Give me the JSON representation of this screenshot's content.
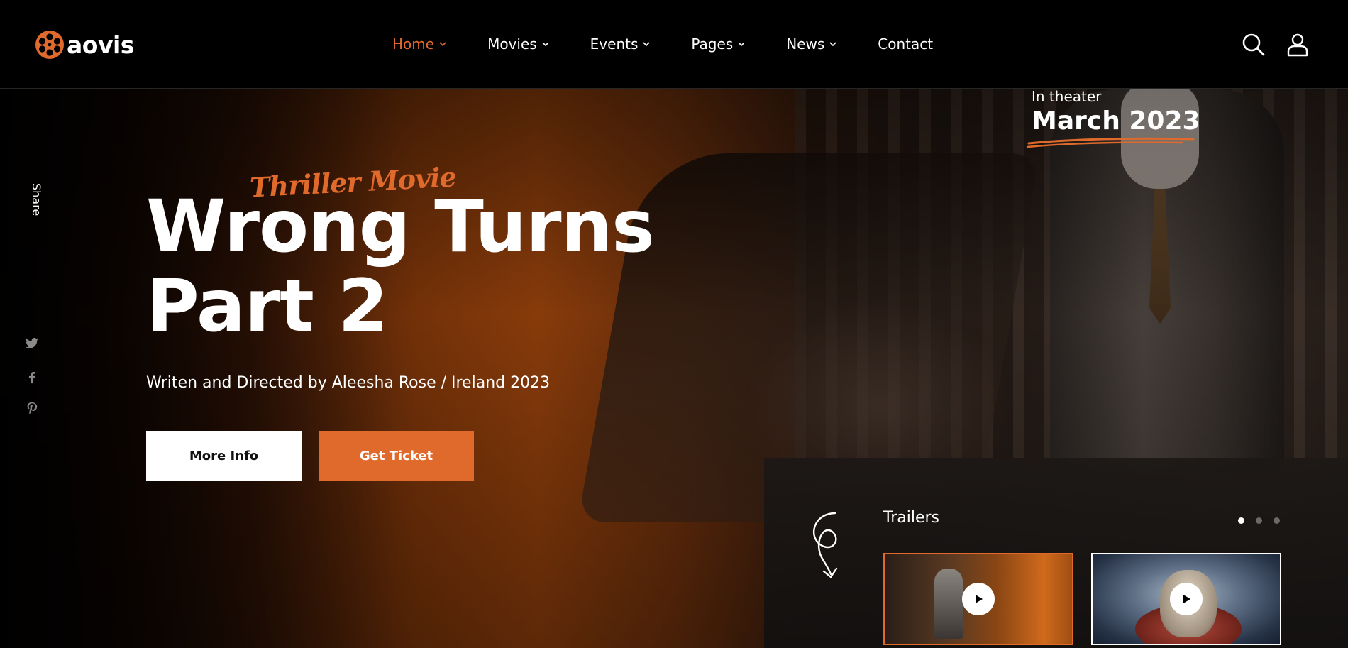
{
  "brand": {
    "name": "aovis"
  },
  "nav": {
    "items": [
      {
        "label": "Home",
        "dropdown": true,
        "active": true
      },
      {
        "label": "Movies",
        "dropdown": true,
        "active": false
      },
      {
        "label": "Events",
        "dropdown": true,
        "active": false
      },
      {
        "label": "Pages",
        "dropdown": true,
        "active": false
      },
      {
        "label": "News",
        "dropdown": true,
        "active": false
      },
      {
        "label": "Contact",
        "dropdown": false,
        "active": false
      }
    ]
  },
  "header_icons": [
    "search-icon",
    "user-icon"
  ],
  "share": {
    "label": "Share",
    "networks": [
      "twitter-icon",
      "facebook-icon",
      "pinterest-icon"
    ]
  },
  "hero": {
    "tagline": "Thriller Movie",
    "title_line1": "Wrong Turns",
    "title_line2": "Part 2",
    "subtitle": "Writen and Directed by Aleesha Rose / Ireland 2023",
    "more_info_label": "More Info",
    "get_ticket_label": "Get Ticket"
  },
  "theater": {
    "label": "In theater",
    "date": "March 2023"
  },
  "trailers": {
    "title": "Trailers",
    "pagination": {
      "count": 3,
      "active_index": 0
    },
    "items": [
      {
        "thumb": "masked-man-trailer",
        "icon": "play-icon",
        "selected": true
      },
      {
        "thumb": "skull-trailer",
        "icon": "play-icon",
        "selected": false
      }
    ]
  },
  "colors": {
    "accent": "#e06a2c",
    "header_bg": "#000000",
    "text": "#ffffff",
    "panel_bg": "#1c1816"
  }
}
